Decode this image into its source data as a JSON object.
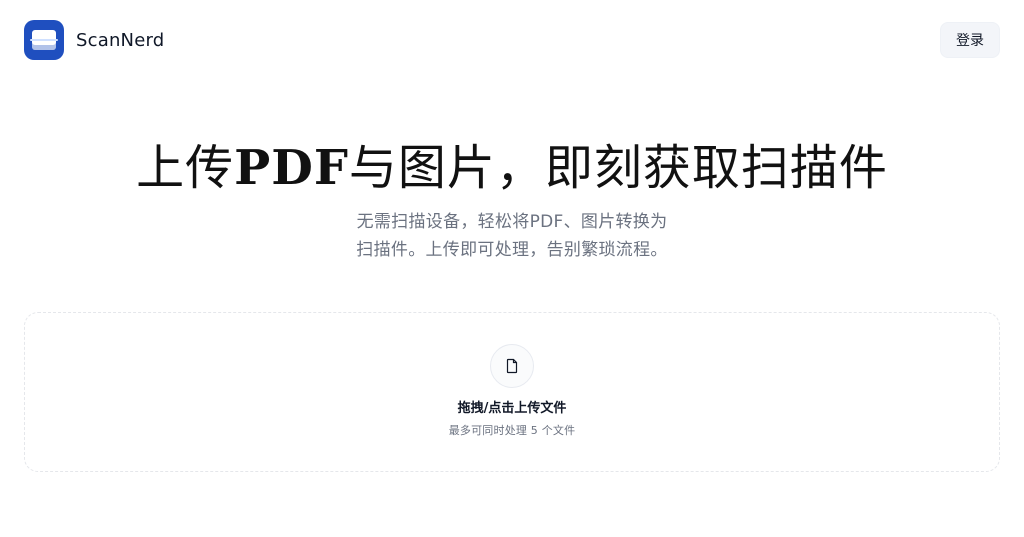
{
  "app": {
    "brand_name": "ScanNerd",
    "login_label": "登录"
  },
  "hero": {
    "title_prefix": "上传",
    "title_emphasis": "PDF",
    "title_suffix": "与图片，即刻获取扫描件",
    "subtitle_line_1": "无需扫描设备，轻松将PDF、图片转换为",
    "subtitle_line_2": "扫描件。上传即可处理，告别繁琐流程。"
  },
  "dropzone": {
    "title": "拖拽/点击上传文件",
    "subtitle": "最多可同时处理 5 个文件",
    "icon": "file-icon"
  },
  "colors": {
    "brand": "#1f4fbf",
    "text_primary": "#111111",
    "text_secondary": "#6b7280",
    "button_bg": "#f3f5f9",
    "border": "#e5e7eb"
  }
}
